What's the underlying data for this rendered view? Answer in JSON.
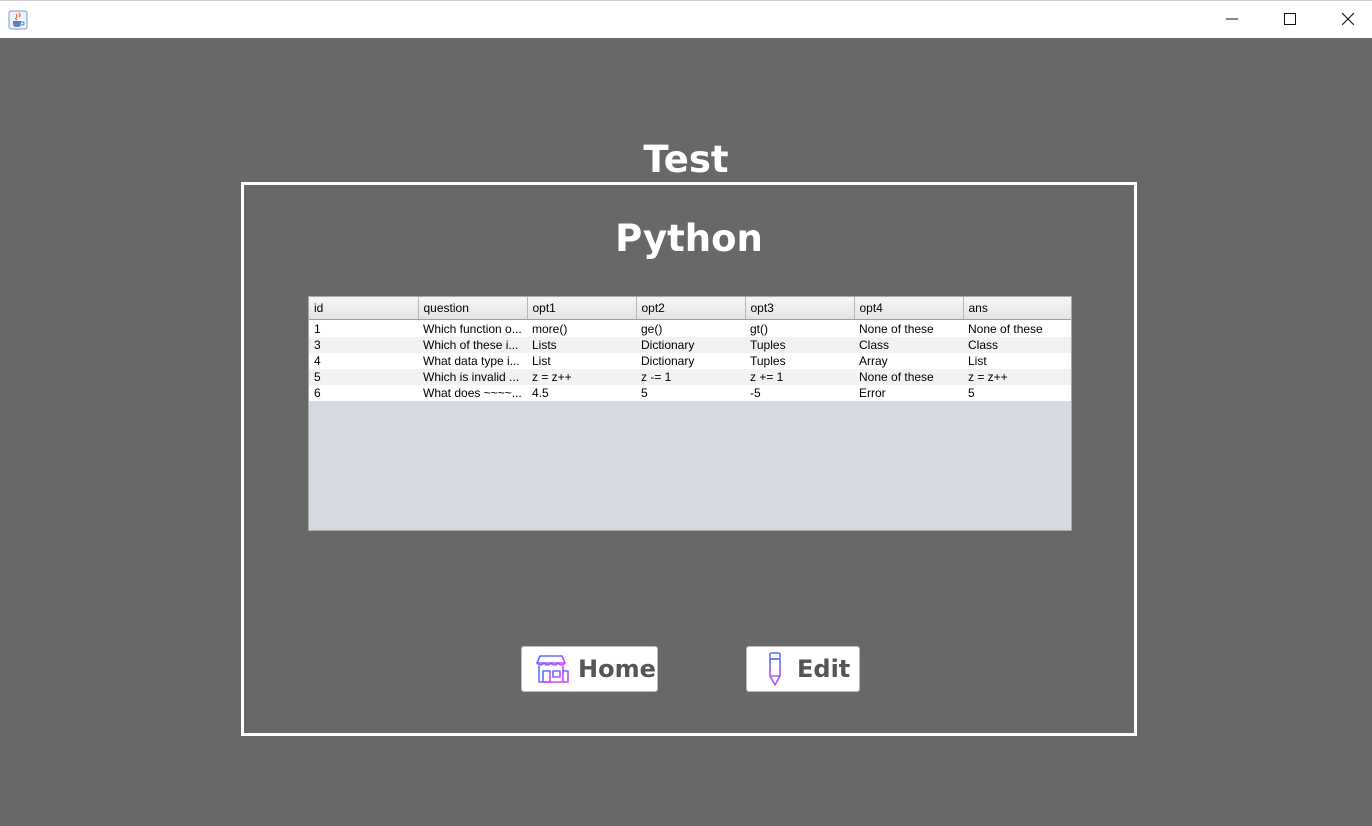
{
  "window": {
    "icon": "java-cup-icon",
    "controls": [
      "minimize-icon",
      "maximize-icon",
      "close-icon"
    ]
  },
  "header": {
    "title": "Test"
  },
  "panel": {
    "title": "Python"
  },
  "table": {
    "columns": [
      "id",
      "question",
      "opt1",
      "opt2",
      "opt3",
      "opt4",
      "ans"
    ],
    "rows": [
      [
        "1",
        "Which function o...",
        "more()",
        "ge()",
        "gt()",
        "None of these",
        "None of these"
      ],
      [
        "3",
        "Which of these i...",
        "Lists",
        "Dictionary",
        "Tuples",
        "Class",
        "Class"
      ],
      [
        "4",
        "What data type i...",
        "List",
        "Dictionary",
        "Tuples",
        "Array",
        "List"
      ],
      [
        "5",
        "Which is invalid ...",
        "z = z++",
        "z -= 1",
        "z += 1",
        "None of these",
        "z = z++"
      ],
      [
        "6",
        "What does ~~~~...",
        "4.5",
        "5",
        "-5",
        "Error",
        "5"
      ]
    ]
  },
  "buttons": {
    "home": {
      "label": "Home",
      "icon": "shop-icon"
    },
    "edit": {
      "label": "Edit",
      "icon": "pencil-icon"
    }
  },
  "colors": {
    "background": "#686868",
    "panel_border": "#ffffff",
    "icon_gradient_start": "#3b7bff",
    "icon_gradient_end": "#e040fb"
  }
}
